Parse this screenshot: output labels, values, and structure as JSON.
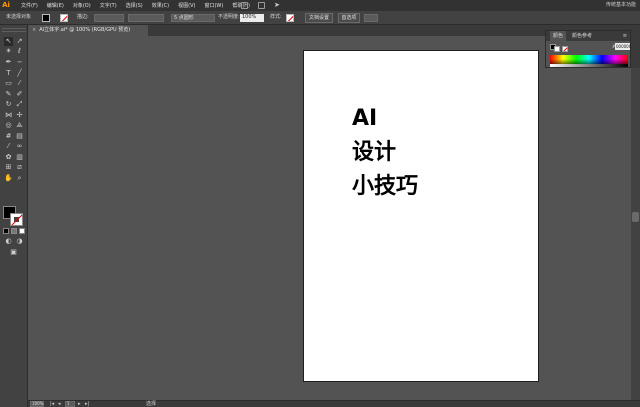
{
  "app": {
    "logo_text": "Ai"
  },
  "menubar": {
    "items": [
      "文件(F)",
      "编辑(E)",
      "对象(O)",
      "文字(T)",
      "选择(S)",
      "效果(C)",
      "视图(V)",
      "窗口(W)",
      "帮助(H)"
    ],
    "right_label": "传统基本功能"
  },
  "controlbar": {
    "selection_label": "未选择对象",
    "stroke_label": "描边:",
    "brush_value": "5 点圆形",
    "opacity_label": "不透明度:",
    "opacity_value": "100%",
    "style_label": "样式:",
    "doc_setup_button": "文档设置",
    "prefs_button": "首选项"
  },
  "document_tab": {
    "title": "AI立体字.ai* @ 100% (RGB/GPU 预览)",
    "close_glyph": "×"
  },
  "artboard": {
    "lines": [
      "AI",
      "设计",
      "小技巧"
    ]
  },
  "panel": {
    "tabs": [
      "颜色",
      "颜色参考"
    ],
    "menu_glyph": "≡",
    "hash": "#",
    "hex_value": "000000"
  },
  "statusbar": {
    "zoom": "100%",
    "page": "1",
    "mode": "选择"
  },
  "colors": {
    "ui_dark": "#323232",
    "ui_panel": "#424242",
    "canvas_bg": "#535353",
    "accent": "#ff9a00",
    "artboard": "#ffffff"
  }
}
